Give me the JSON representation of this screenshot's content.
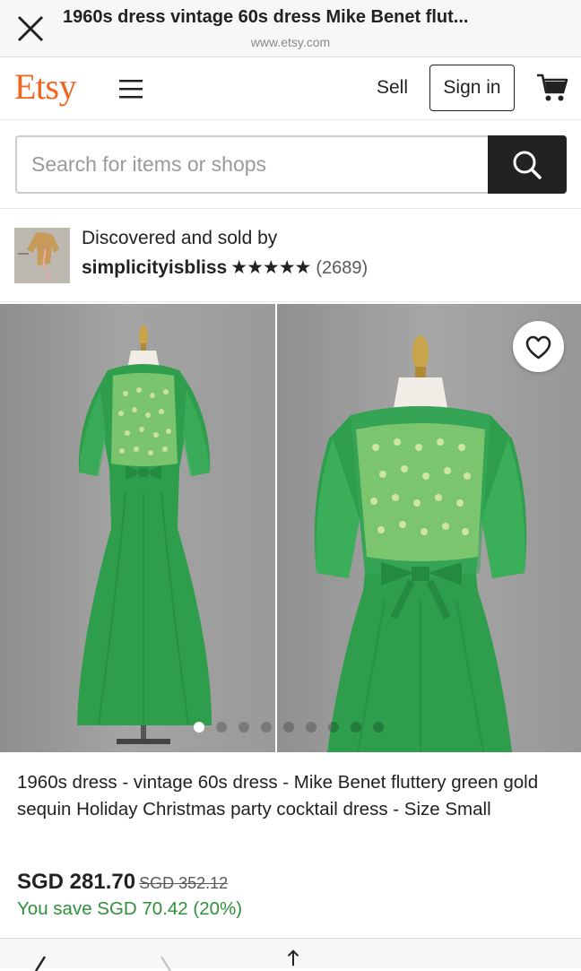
{
  "browser": {
    "title": "1960s dress vintage 60s dress Mike Benet flut...",
    "url": "www.etsy.com"
  },
  "header": {
    "logo": "Etsy",
    "sell": "Sell",
    "sign_in": "Sign in"
  },
  "search": {
    "placeholder": "Search for items or shops"
  },
  "seller": {
    "label": "Discovered and sold by",
    "name": "simplicityisbliss",
    "stars": "★★★★★",
    "reviews": "(2689)"
  },
  "gallery": {
    "image_count": 9,
    "active_index": 0
  },
  "product": {
    "title": "1960s dress - vintage 60s dress - Mike Benet fluttery green gold sequin Holiday Christmas party cocktail dress - Size Small",
    "price": "SGD 281.70",
    "original_price": "SGD 352.12",
    "savings": "You save SGD 70.42 (20%)"
  },
  "colors": {
    "brand": "#f1641e",
    "savings": "#2f8f3a",
    "dress": "#2e9e4d"
  }
}
